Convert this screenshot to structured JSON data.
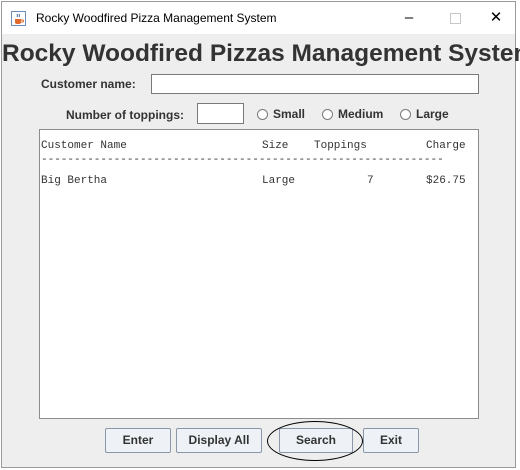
{
  "window": {
    "title": "Rocky Woodfired Pizza Management System",
    "controls": {
      "minimize": "–",
      "maximize": "",
      "close": "✕"
    }
  },
  "heading": "Rocky Woodfired Pizzas Management System",
  "form": {
    "customer_name_label": "Customer name:",
    "customer_name_value": "",
    "toppings_label": "Number of toppings:",
    "toppings_value": "",
    "sizes": [
      {
        "label": "Small",
        "selected": false
      },
      {
        "label": "Medium",
        "selected": false
      },
      {
        "label": "Large",
        "selected": false
      }
    ]
  },
  "output": {
    "headers": {
      "name": "Customer Name",
      "size": "Size",
      "toppings": "Toppings",
      "charge": "Charge"
    },
    "separator": "-------------------------------------------------------------",
    "rows": [
      {
        "name": "Big Bertha",
        "size": "Large",
        "toppings": "7",
        "charge": "$26.75"
      }
    ]
  },
  "buttons": {
    "enter": "Enter",
    "display_all": "Display All",
    "search": "Search",
    "exit": "Exit"
  },
  "icons": {
    "app": "java-coffee-cup-icon"
  },
  "colors": {
    "button_bg": "#eef2f7",
    "button_border": "#8a97a8",
    "text": "#333333"
  }
}
